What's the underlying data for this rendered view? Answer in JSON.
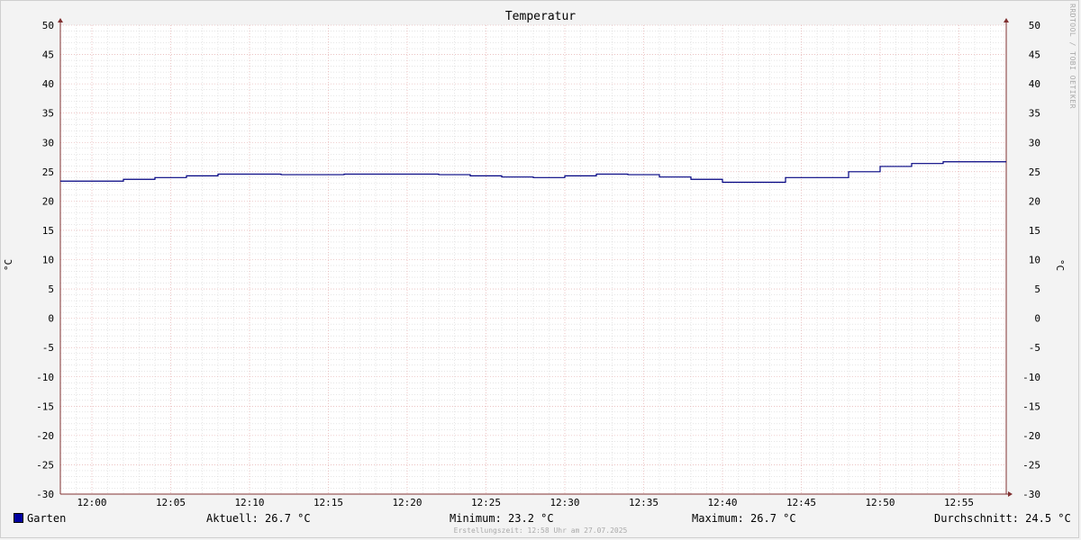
{
  "chart_data": {
    "type": "line",
    "title": "Temperatur",
    "ylabel": "°C",
    "ylim": [
      -30,
      50
    ],
    "y_ticks": [
      50,
      45,
      40,
      35,
      30,
      25,
      20,
      15,
      10,
      5,
      0,
      -5,
      -10,
      -15,
      -20,
      -25,
      -30
    ],
    "x_tick_labels": [
      "12:00",
      "12:05",
      "12:10",
      "12:15",
      "12:20",
      "12:25",
      "12:30",
      "12:35",
      "12:40",
      "12:45",
      "12:50",
      "12:55"
    ],
    "x_tick_minutes": [
      0,
      5,
      10,
      15,
      20,
      25,
      30,
      35,
      40,
      45,
      50,
      55
    ],
    "x_range_minutes": [
      -2,
      58
    ],
    "series": [
      {
        "name": "Garten",
        "color": "#000080",
        "step": true,
        "x_minutes": [
          -2,
          2,
          4,
          6,
          8,
          12,
          16,
          22,
          24,
          26,
          28,
          30,
          32,
          34,
          36,
          38,
          40,
          44,
          48,
          50,
          52,
          54,
          58
        ],
        "values": [
          23.4,
          23.7,
          24.0,
          24.3,
          24.6,
          24.5,
          24.6,
          24.5,
          24.3,
          24.1,
          24.0,
          24.3,
          24.6,
          24.5,
          24.1,
          23.7,
          23.2,
          24.0,
          25.0,
          25.9,
          26.4,
          26.7,
          26.7
        ]
      }
    ],
    "grid": true
  },
  "watermark": "RRDTOOL / TOBI OETIKER",
  "legend": {
    "series_name": "Garten",
    "swatch_color": "#0000a0",
    "current": "Aktuell: 26.7 °C",
    "minimum": "Minimum: 23.2 °C",
    "maximum": "Maximum: 26.7 °C",
    "average": "Durchschnitt: 24.5 °C"
  },
  "footer": "Erstellungszeit: 12:58 Uhr am 27.07.2025",
  "colors": {
    "background": "#f3f3f3",
    "plot_background": "#ffffff",
    "major_grid": "#e0a0a0",
    "minor_grid": "#cccccc",
    "axis": "#803030",
    "line": "#000080"
  }
}
